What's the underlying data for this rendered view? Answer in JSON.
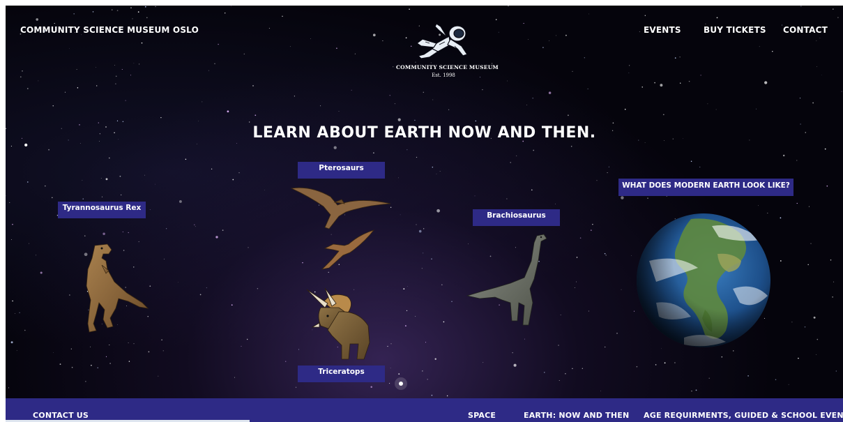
{
  "header": {
    "site_name": "COMMUNITY SCIENCE MUSEUM OSLO",
    "nav": {
      "events": "EVENTS",
      "buy_tickets": "BUY TICKETS",
      "contact": "CONTACT"
    },
    "logo": {
      "title": "COMMUNITY SCIENCE MUSEUM",
      "est": "Est. 1998"
    }
  },
  "main": {
    "headline": "LEARN ABOUT EARTH NOW AND THEN.",
    "labels": {
      "pterosaurs": "Pterosaurs",
      "trex": "Tyrannosaurus Rex",
      "brachiosaurus": "Brachiosaurus",
      "triceratops": "Triceratops",
      "modern_earth": "WHAT DOES MODERN EARTH LOOK LIKE?"
    }
  },
  "footer": {
    "contact_us": "CONTACT US",
    "space": "SPACE",
    "earth": "EARTH: NOW AND THEN",
    "age": "AGE REQUIRMENTS, GUIDED & SCHOOL EVENTS"
  },
  "colors": {
    "label_bg": "#2e2a86",
    "background": "#05040c",
    "text": "#ffffff"
  },
  "icons": [
    "astronaut-logo-icon",
    "trex-image",
    "pterosaur-image",
    "triceratops-image",
    "brachiosaurus-image",
    "earth-globe-image"
  ]
}
